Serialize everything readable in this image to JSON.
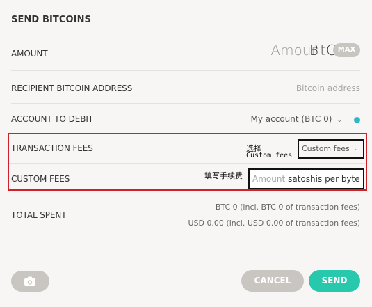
{
  "header": {
    "title": "SEND BITCOINS"
  },
  "amount": {
    "label": "AMOUNT",
    "placeholder": "Amount",
    "unit": "BTC",
    "max_label": "MAX"
  },
  "recipient": {
    "label": "RECIPIENT BITCOIN ADDRESS",
    "placeholder": "Bitcoin address"
  },
  "account": {
    "label": "ACCOUNT TO DEBIT",
    "selected": "My account (BTC 0)",
    "status_color": "#2fb7c6"
  },
  "transaction_fees": {
    "label": "TRANSACTION FEES",
    "selected": "Custom fees",
    "note_line1": "选择",
    "note_line2": "Custom fees"
  },
  "custom_fees": {
    "label": "CUSTOM FEES",
    "placeholder": "Amount",
    "unit": "satoshis per byte",
    "note": "填写手续费"
  },
  "total": {
    "label": "TOTAL SPENT",
    "btc_line": "BTC 0 (incl. BTC 0 of transaction fees)",
    "usd_line": "USD 0.00 (incl. USD 0.00 of transaction fees)"
  },
  "footer": {
    "camera_icon": "camera-icon",
    "cancel_label": "CANCEL",
    "send_label": "SEND"
  },
  "colors": {
    "accent": "#27c8ac",
    "highlight_border": "#d0212a",
    "muted_button": "#c9c6c1"
  }
}
